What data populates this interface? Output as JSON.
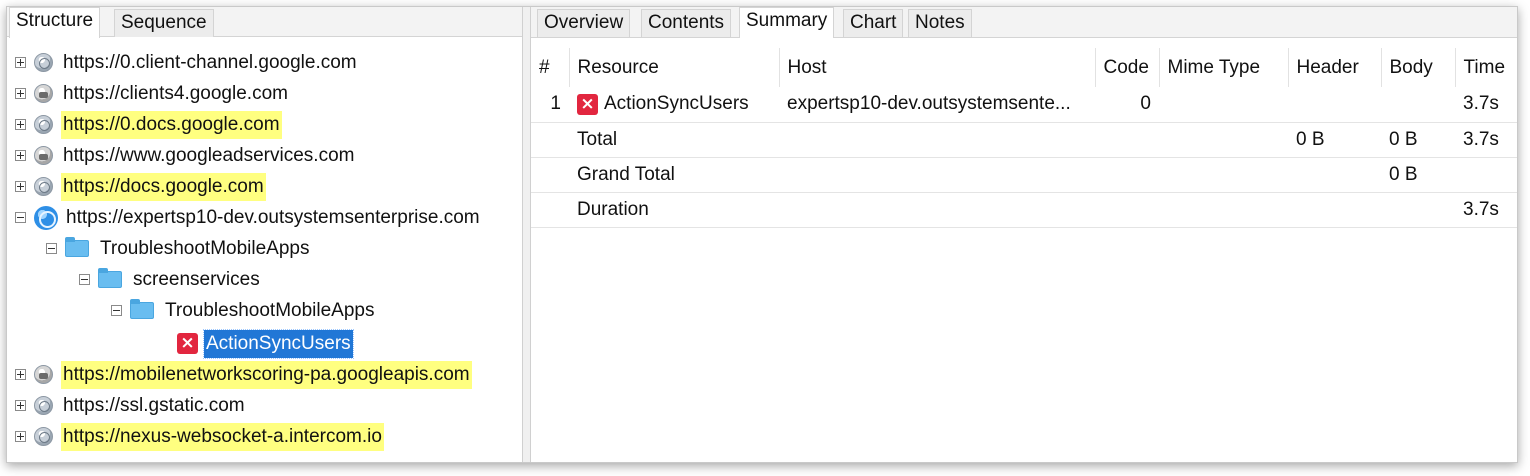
{
  "left_tabs": [
    "Structure",
    "Sequence"
  ],
  "right_tabs": [
    "Overview",
    "Contents",
    "Summary",
    "Chart",
    "Notes"
  ],
  "tree": [
    {
      "label": "https://0.client-channel.google.com",
      "icon": "globe-icon"
    },
    {
      "label": "https://clients4.google.com",
      "icon": "lock-globe-icon"
    },
    {
      "label": "https://0.docs.google.com",
      "icon": "globe-icon"
    },
    {
      "label": "https://www.googleadservices.com",
      "icon": "lock-globe-icon"
    },
    {
      "label": "https://docs.google.com",
      "icon": "globe-icon"
    },
    {
      "label": "https://expertsp10-dev.outsystemsenterprise.com",
      "icon": "globe-icon"
    },
    {
      "label": "TroubleshootMobileApps",
      "icon": "folder-icon"
    },
    {
      "label": "screenservices",
      "icon": "folder-icon"
    },
    {
      "label": "TroubleshootMobileApps",
      "icon": "folder-icon"
    },
    {
      "label": "ActionSyncUsers",
      "icon": "error-icon"
    },
    {
      "label": "https://mobilenetworkscoring-pa.googleapis.com",
      "icon": "lock-globe-icon"
    },
    {
      "label": "https://ssl.gstatic.com",
      "icon": "globe-icon"
    },
    {
      "label": "https://nexus-websocket-a.intercom.io",
      "icon": "globe-icon"
    }
  ],
  "summary": {
    "columns": [
      "#",
      "Resource",
      "Host",
      "Code",
      "Mime Type",
      "Header",
      "Body",
      "Time"
    ],
    "row1": {
      "num": "1",
      "resource": "ActionSyncUsers",
      "host": "expertsp10-dev.outsystemsente...",
      "code": "0",
      "time": "3.7s"
    },
    "total": {
      "label": "Total",
      "header": "0 B",
      "body": "0 B",
      "time": "3.7s"
    },
    "grand_total": {
      "label": "Grand Total",
      "body": "0 B"
    },
    "duration": {
      "label": "Duration",
      "time": "3.7s"
    }
  },
  "colors": {
    "highlight": "#ffff80",
    "selection": "#2177d6",
    "error": "#e2263f"
  }
}
